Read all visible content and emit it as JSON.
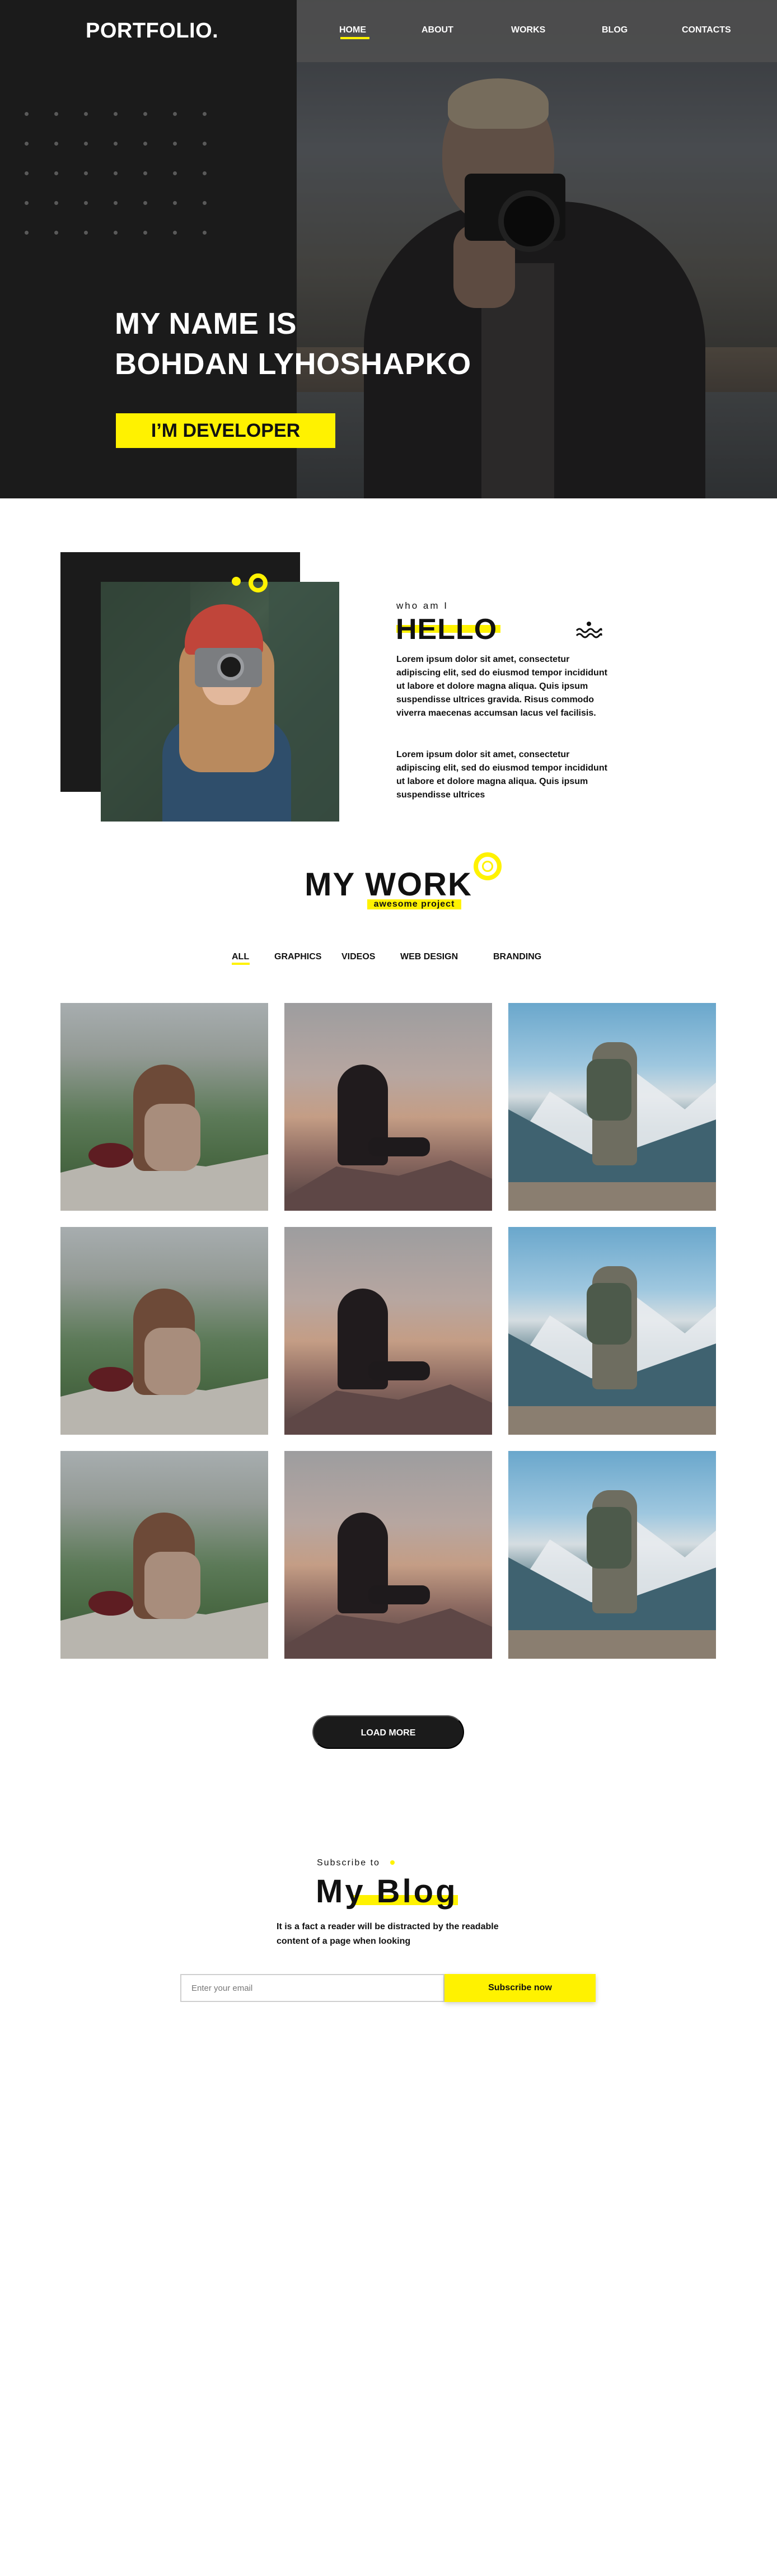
{
  "nav": {
    "logo": "PORTFOLIO.",
    "items": [
      {
        "label": "HOME"
      },
      {
        "label": "ABOUT"
      },
      {
        "label": "WORKS"
      },
      {
        "label": "BLOG"
      },
      {
        "label": "CONTACTS"
      }
    ]
  },
  "hero": {
    "title_line1": "MY NAME IS",
    "title_line2": "BOHDAN LYHOSHAPKO",
    "badge": "I’M DEVELOPER"
  },
  "about": {
    "label": "who am I",
    "heading": "HELLO",
    "paragraph1": "Lorem ipsum dolor sit amet, consectetur adipiscing elit, sed do eiusmod tempor incididunt ut labore et dolore magna aliqua. Quis ipsum suspendisse ultrices gravida. Risus commodo viverra maecenas accumsan lacus vel facilisis.",
    "paragraph2": "Lorem ipsum dolor sit amet, consectetur adipiscing elit, sed do eiusmod tempor incididunt ut labore et dolore magna aliqua. Quis ipsum suspendisse ultrices"
  },
  "work": {
    "title": "MY WORK",
    "subtitle": "awesome project",
    "filters": [
      {
        "label": "ALL"
      },
      {
        "label": "GRAPHICS"
      },
      {
        "label": "VIDEOS"
      },
      {
        "label": "WEB DESIGN"
      },
      {
        "label": "BRANDING"
      }
    ],
    "load_more": "LOAD MORE"
  },
  "subscribe": {
    "label": "Subscribe to",
    "title": "My Blog",
    "description": "It is a fact a reader will be distracted by the readable content of a page when looking",
    "email_placeholder": "Enter your email",
    "button": "Subscribe now"
  },
  "colors": {
    "accent": "#fff200",
    "dark": "#1b1b1b",
    "background": "#ffffff"
  },
  "icons": [
    "waves-icon",
    "ring-icon"
  ]
}
